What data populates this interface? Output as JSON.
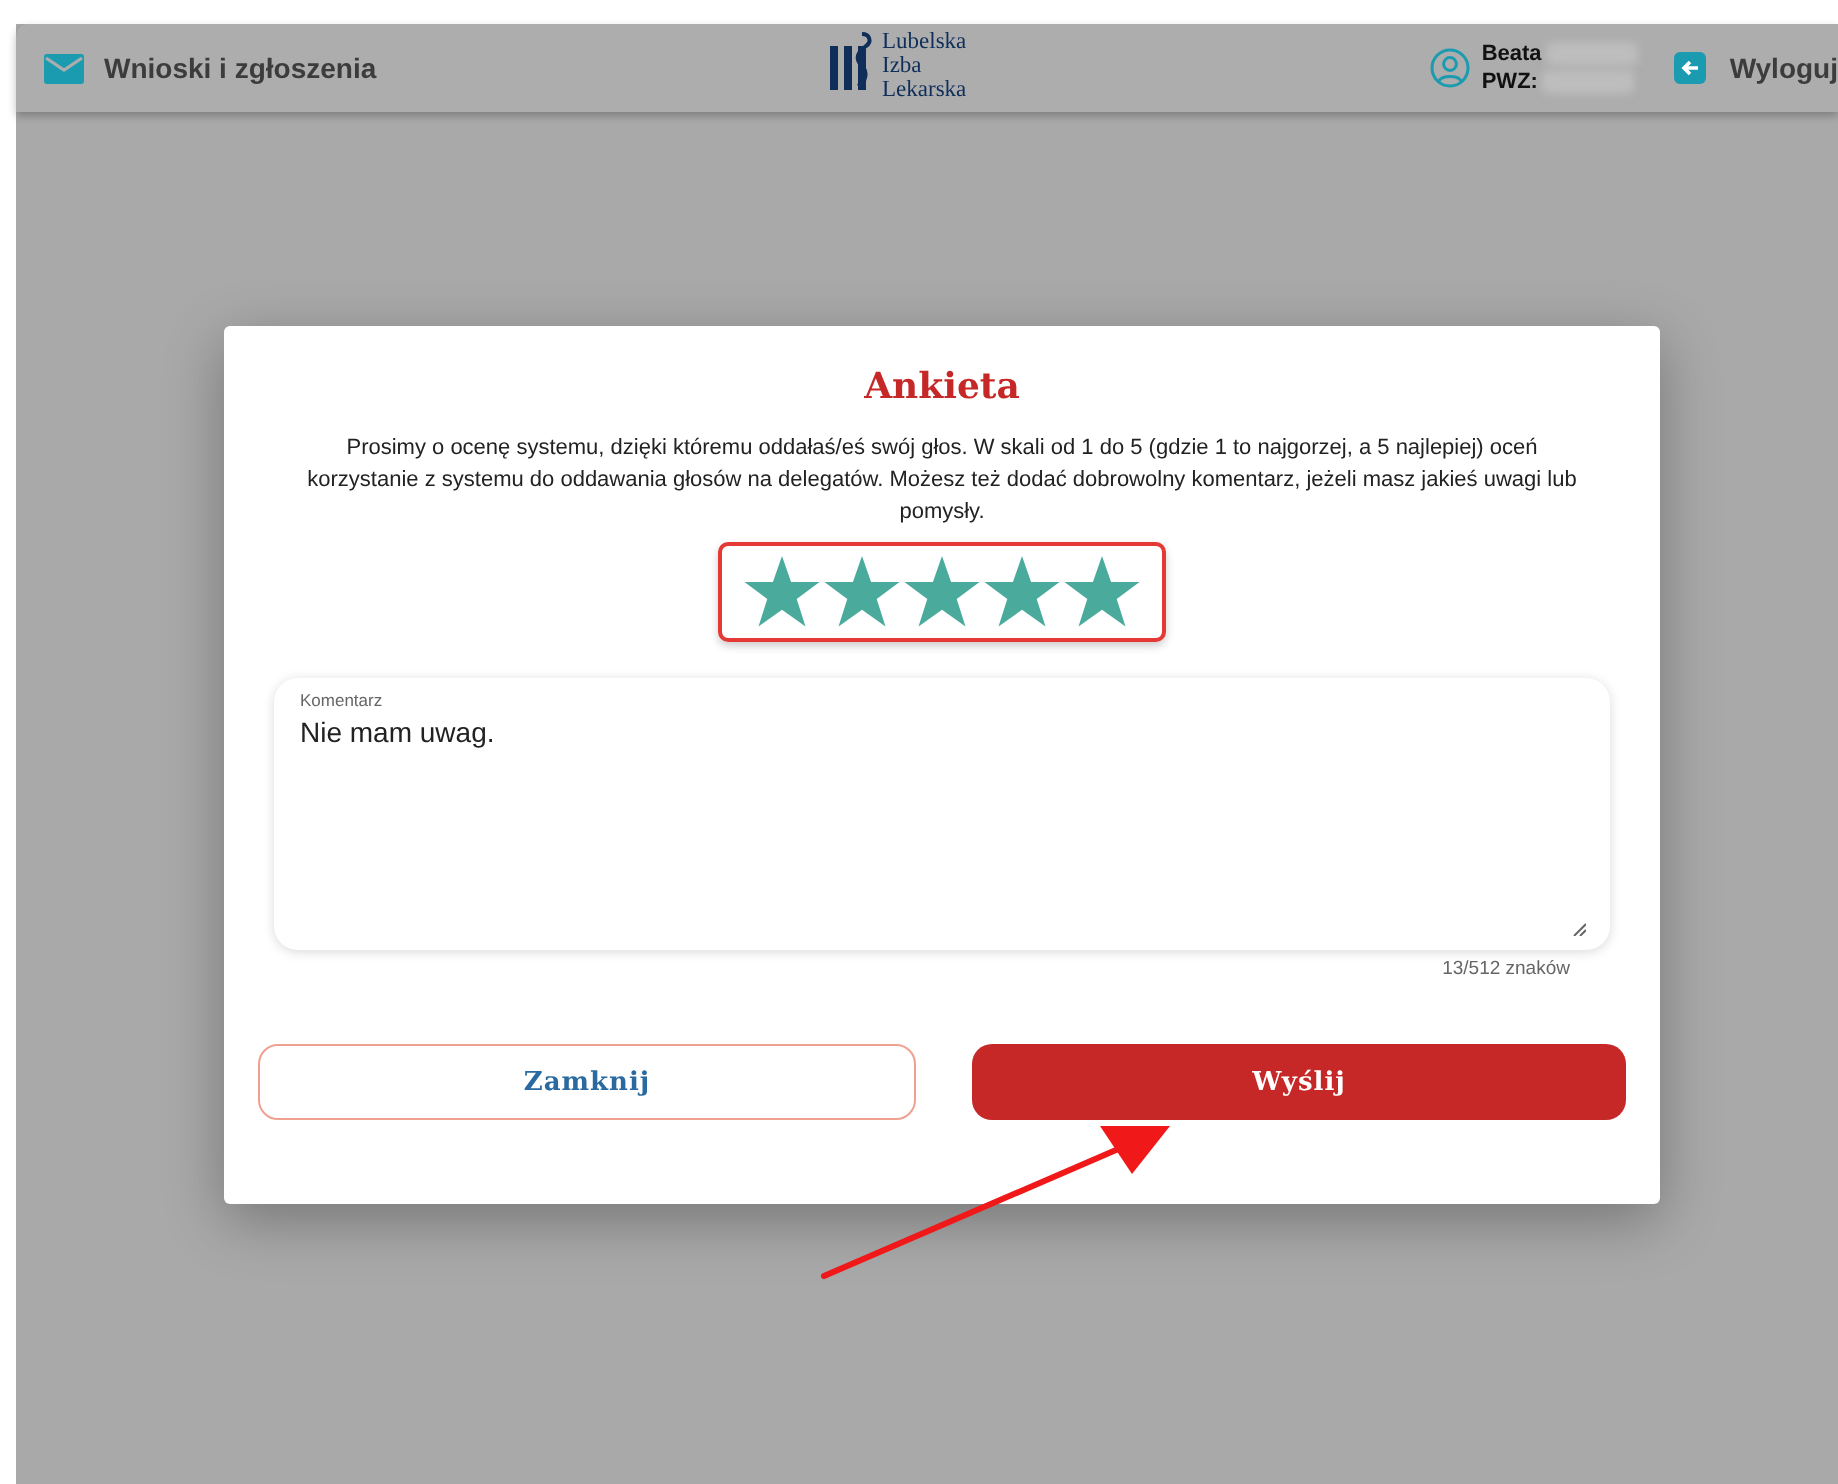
{
  "header": {
    "nav_label": "Wnioski i zgłoszenia",
    "logo_lines": [
      "Lubelska",
      "Izba",
      "Lekarska"
    ],
    "user_first_name": "Beata",
    "user_id_label": "PWZ:",
    "logout_label": "Wyloguj"
  },
  "dialog": {
    "title": "Ankieta",
    "description": "Prosimy o ocenę systemu, dzięki któremu oddałaś/eś swój głos. W skali od 1 do 5 (gdzie 1 to najgorzej, a 5 najlepiej) oceń korzystanie z systemu do oddawania głosów na delegatów. Możesz też dodać dobrowolny komentarz, jeżeli masz jakieś uwagi lub pomysły.",
    "rating": {
      "stars": 5,
      "highlighted": true
    },
    "comment": {
      "label": "Komentarz",
      "value": "Nie mam uwag.",
      "counter": "13/512 znaków"
    },
    "buttons": [
      {
        "label": "Zamknij",
        "kind": "outline"
      },
      {
        "label": "Wyślij",
        "kind": "primary"
      }
    ]
  },
  "annotation": {
    "arrow": true
  }
}
